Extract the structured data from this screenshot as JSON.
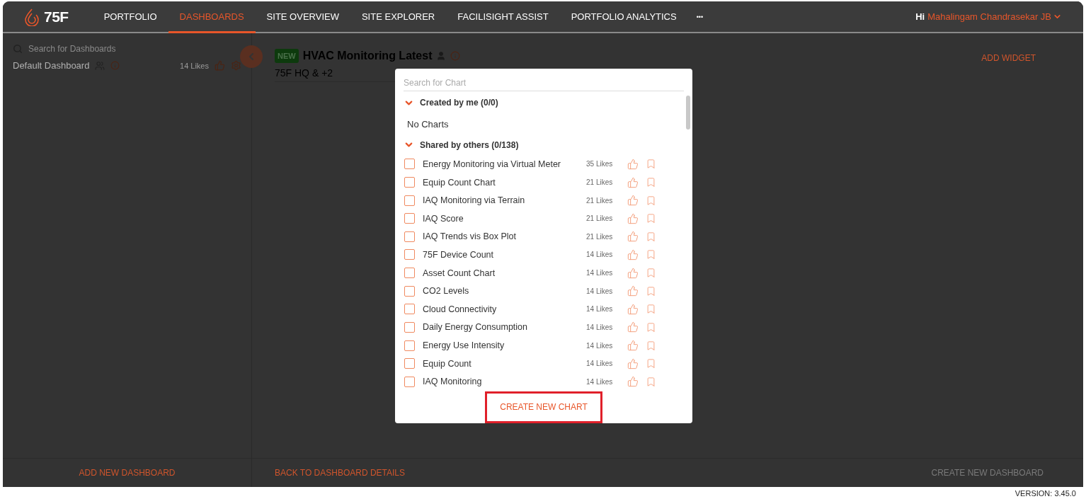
{
  "nav": {
    "logo": "75F",
    "tabs": [
      {
        "label": "PORTFOLIO",
        "selected": false
      },
      {
        "label": "DASHBOARDS",
        "selected": true
      },
      {
        "label": "SITE OVERVIEW",
        "selected": false
      },
      {
        "label": "SITE EXPLORER",
        "selected": false
      },
      {
        "label": "FACILISIGHT ASSIST",
        "selected": false
      },
      {
        "label": "PORTFOLIO ANALYTICS",
        "selected": false
      }
    ],
    "more": "•••",
    "greeting": "Hi",
    "user": "Mahalingam Chandrasekar JB"
  },
  "sidebar": {
    "search": {
      "placeholder": "Search for Dashboards"
    },
    "dashboards": [
      {
        "name": "Default Dashboard",
        "likes": "14 Likes"
      }
    ],
    "add_button": "ADD NEW DASHBOARD"
  },
  "main": {
    "badge": "NEW",
    "title": "HVAC Monitoring Latest",
    "subtitle": "75F HQ & +2",
    "add_widget": "ADD WIDGET",
    "back_button": "BACK TO DASHBOARD DETAILS",
    "create_dashboard": {
      "label": "CREATE NEW DASHBOARD",
      "disabled": true
    }
  },
  "modal": {
    "search": {
      "placeholder": "Search for Chart"
    },
    "groups": [
      {
        "title": "Created by me (0/0)",
        "expanded": true,
        "empty_text": "No Charts"
      },
      {
        "title": "Shared by others (0/138)",
        "expanded": true,
        "charts": [
          {
            "name": "Energy Monitoring via Virtual Meter",
            "likes": "35 Likes",
            "checked": false
          },
          {
            "name": "Equip Count Chart",
            "likes": "21 Likes",
            "checked": false
          },
          {
            "name": "IAQ Monitoring via Terrain",
            "likes": "21 Likes",
            "checked": false
          },
          {
            "name": "IAQ Score",
            "likes": "21 Likes",
            "checked": false
          },
          {
            "name": "IAQ Trends vis Box Plot",
            "likes": "21 Likes",
            "checked": false
          },
          {
            "name": "75F Device Count",
            "likes": "14 Likes",
            "checked": false
          },
          {
            "name": "Asset Count Chart",
            "likes": "14 Likes",
            "checked": false
          },
          {
            "name": "CO2 Levels",
            "likes": "14 Likes",
            "checked": false
          },
          {
            "name": "Cloud Connectivity",
            "likes": "14 Likes",
            "checked": false
          },
          {
            "name": "Daily Energy Consumption",
            "likes": "14 Likes",
            "checked": false
          },
          {
            "name": "Energy Use Intensity",
            "likes": "14 Likes",
            "checked": false
          },
          {
            "name": "Equip Count",
            "likes": "14 Likes",
            "checked": false
          },
          {
            "name": "IAQ Monitoring",
            "likes": "14 Likes",
            "checked": false
          }
        ]
      }
    ],
    "create_button": "CREATE NEW CHART"
  },
  "version": "VERSION: 3.45.0"
}
